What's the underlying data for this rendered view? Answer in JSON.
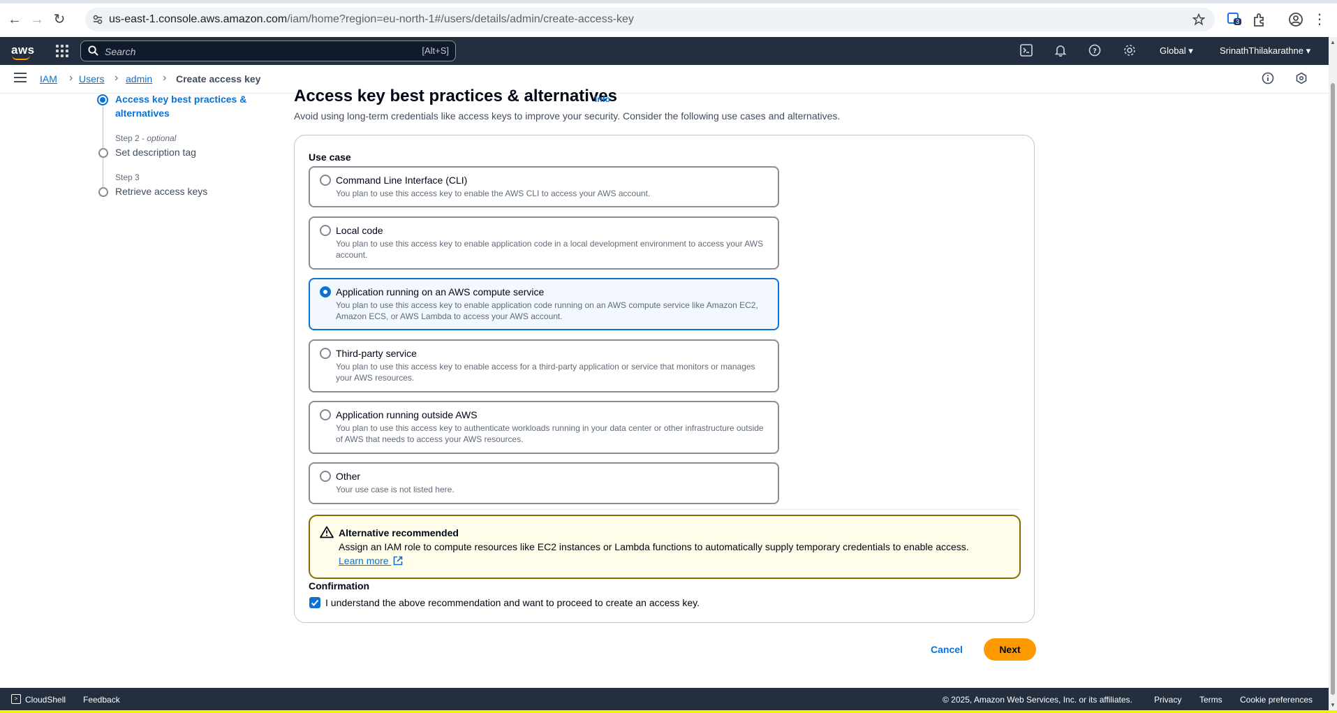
{
  "browser": {
    "url_host": "us-east-1.console.aws.amazon.com",
    "url_path": "/iam/home?region=eu-north-1#/users/details/admin/create-access-key",
    "extension_badge": "3"
  },
  "topnav": {
    "logo": "aws",
    "search_placeholder": "Search",
    "search_shortcut": "[Alt+S]",
    "region": "Global",
    "account": "SrinathThilakarathne"
  },
  "breadcrumb": {
    "items": [
      "IAM",
      "Users",
      "admin"
    ],
    "current": "Create access key"
  },
  "steps": [
    {
      "label": "Access key best practices &",
      "label2": "alternatives",
      "state": "active"
    },
    {
      "prefix": "Step 2 - ",
      "prefix_em": "optional",
      "label": "Set description tag"
    },
    {
      "prefix": "Step 3",
      "label": "Retrieve access keys"
    }
  ],
  "page": {
    "title": "Access key best practices & alternatives",
    "info": "Info",
    "subtitle": "Avoid using long-term credentials like access keys to improve your security. Consider the following use cases and alternatives."
  },
  "use_case": {
    "label": "Use case",
    "selected_index": 2,
    "options": [
      {
        "title": "Command Line Interface (CLI)",
        "desc": "You plan to use this access key to enable the AWS CLI to access your AWS account."
      },
      {
        "title": "Local code",
        "desc": "You plan to use this access key to enable application code in a local development environment to access your AWS account."
      },
      {
        "title": "Application running on an AWS compute service",
        "desc": "You plan to use this access key to enable application code running on an AWS compute service like Amazon EC2, Amazon ECS, or AWS Lambda to access your AWS account."
      },
      {
        "title": "Third-party service",
        "desc": "You plan to use this access key to enable access for a third-party application or service that monitors or manages your AWS resources."
      },
      {
        "title": "Application running outside AWS",
        "desc": "You plan to use this access key to authenticate workloads running in your data center or other infrastructure outside of AWS that needs to access your AWS resources."
      },
      {
        "title": "Other",
        "desc": "Your use case is not listed here."
      }
    ]
  },
  "alert": {
    "title": "Alternative recommended",
    "body": "Assign an IAM role to compute resources like EC2 instances or Lambda functions to automatically supply temporary credentials to enable access.",
    "link": "Learn more"
  },
  "confirmation": {
    "label": "Confirmation",
    "checkbox_text": "I understand the above recommendation and want to proceed to create an access key.",
    "checked": true
  },
  "actions": {
    "cancel": "Cancel",
    "next": "Next"
  },
  "footer": {
    "cloudshell": "CloudShell",
    "feedback": "Feedback",
    "copyright": "© 2025, Amazon Web Services, Inc. or its affiliates.",
    "privacy": "Privacy",
    "terms": "Terms",
    "cookies": "Cookie preferences"
  },
  "colors": {
    "aws_nav": "#232f3e",
    "link_blue": "#0972d3",
    "primary_orange": "#ff9900",
    "warning_border": "#8d6605",
    "warning_bg": "#fffce9"
  }
}
